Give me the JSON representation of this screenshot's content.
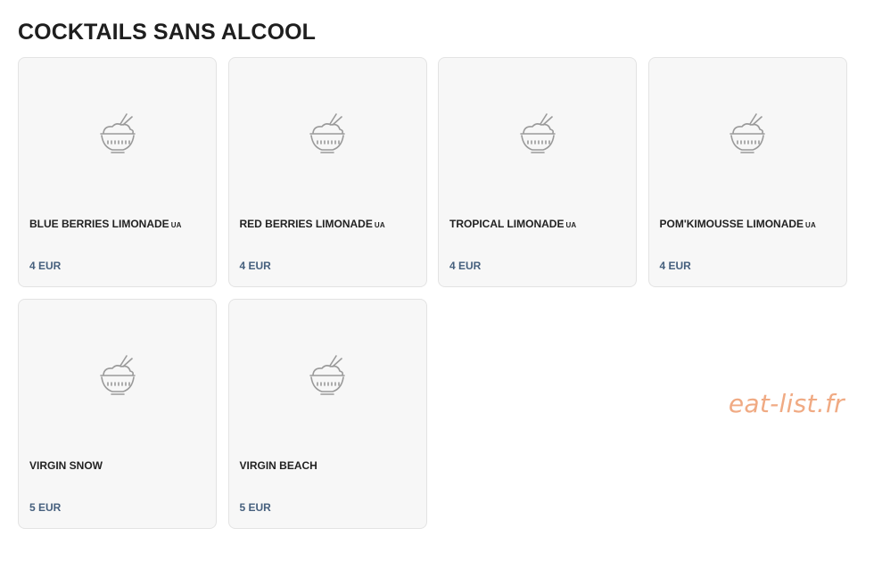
{
  "section": {
    "title": "COCKTAILS SANS ALCOOL"
  },
  "items": [
    {
      "name": "BLUE BERRIES LIMONADE",
      "tag": "UA",
      "price": "4 EUR",
      "icon": "rice-bowl-icon"
    },
    {
      "name": "RED BERRIES LIMONADE",
      "tag": "UA",
      "price": "4 EUR",
      "icon": "rice-bowl-icon"
    },
    {
      "name": "TROPICAL LIMONADE",
      "tag": "UA",
      "price": "4 EUR",
      "icon": "rice-bowl-icon"
    },
    {
      "name": "POM'KIMOUSSE LIMONADE",
      "tag": "UA",
      "price": "4 EUR",
      "icon": "rice-bowl-icon"
    },
    {
      "name": "VIRGIN SNOW",
      "tag": "",
      "price": "5 EUR",
      "icon": "rice-bowl-icon"
    },
    {
      "name": "VIRGIN BEACH",
      "tag": "",
      "price": "5 EUR",
      "icon": "rice-bowl-icon"
    }
  ],
  "watermark": "eat-list.fr",
  "colors": {
    "card_background": "#f7f7f7",
    "price": "#46607e",
    "watermark": "#f0aa83"
  }
}
